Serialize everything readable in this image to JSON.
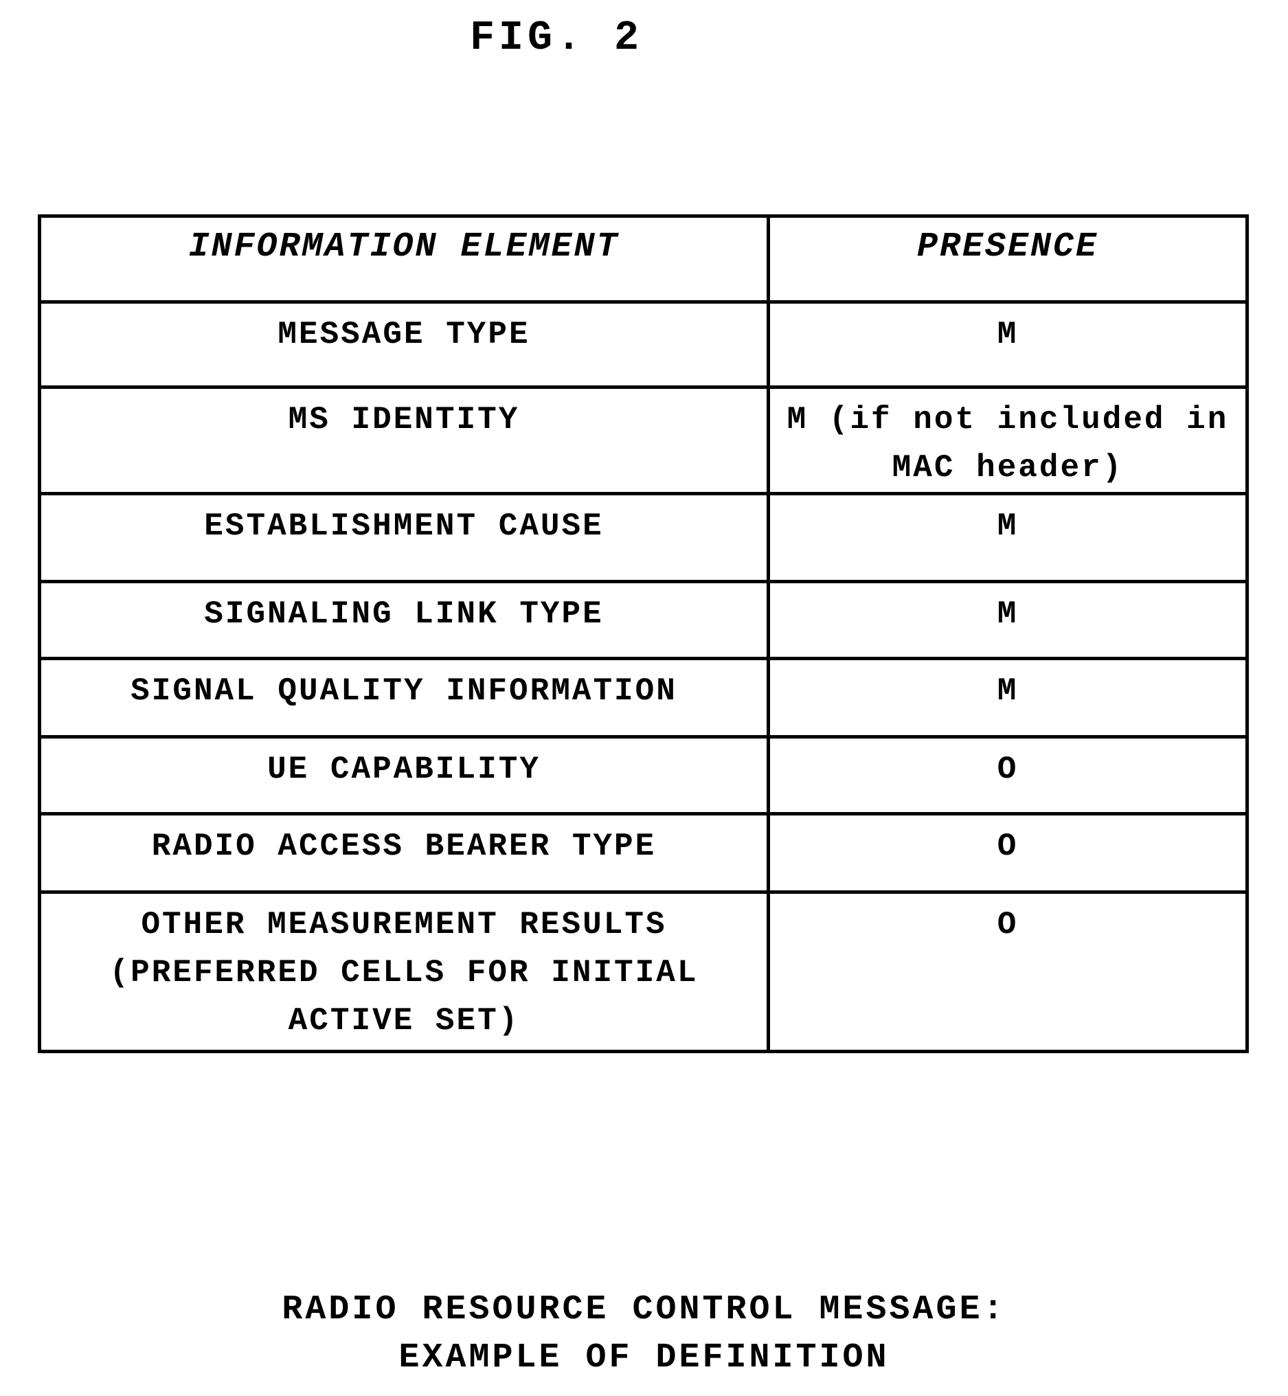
{
  "figure": {
    "title": "FIG. 2"
  },
  "table": {
    "headers": [
      "INFORMATION ELEMENT",
      "PRESENCE"
    ],
    "rows": [
      {
        "element": "MESSAGE TYPE",
        "presence": "M"
      },
      {
        "element": "MS IDENTITY",
        "presence": "M (if not included in MAC header)"
      },
      {
        "element": "ESTABLISHMENT CAUSE",
        "presence": "M"
      },
      {
        "element": "SIGNALING LINK TYPE",
        "presence": "M"
      },
      {
        "element": "SIGNAL QUALITY INFORMATION",
        "presence": "M"
      },
      {
        "element": "UE CAPABILITY",
        "presence": "O"
      },
      {
        "element": "RADIO ACCESS BEARER TYPE",
        "presence": "O"
      },
      {
        "element": "OTHER MEASUREMENT RESULTS (PREFERRED CELLS FOR INITIAL ACTIVE SET)",
        "presence": "O"
      }
    ]
  },
  "caption": {
    "line1": "RADIO RESOURCE CONTROL MESSAGE:",
    "line2": "EXAMPLE OF DEFINITION"
  }
}
